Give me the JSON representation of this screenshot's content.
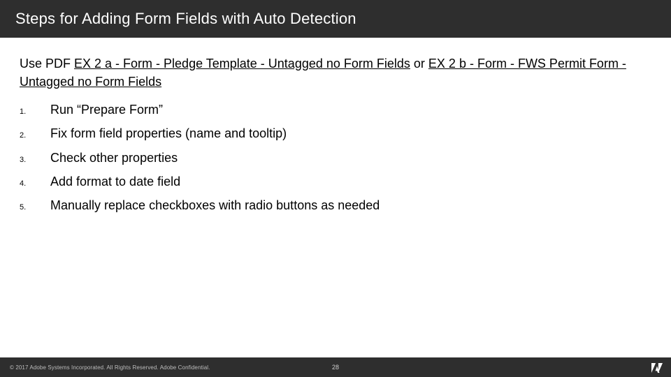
{
  "title": "Steps for Adding Form Fields with Auto Detection",
  "intro": {
    "prefix": " Use PDF ",
    "link1": "EX 2 a - Form - Pledge Template - Untagged no Form Fields",
    "mid": " or ",
    "link2": "EX 2 b - Form - FWS Permit Form - Untagged no Form Fields"
  },
  "steps": [
    "Run “Prepare Form”",
    "Fix form field properties (name and tooltip)",
    "Check other properties",
    "Add format to date field",
    "Manually replace checkboxes with radio buttons as needed"
  ],
  "footer": {
    "copyright": "© 2017 Adobe Systems Incorporated.  All Rights Reserved.  Adobe Confidential.",
    "page": "28"
  }
}
